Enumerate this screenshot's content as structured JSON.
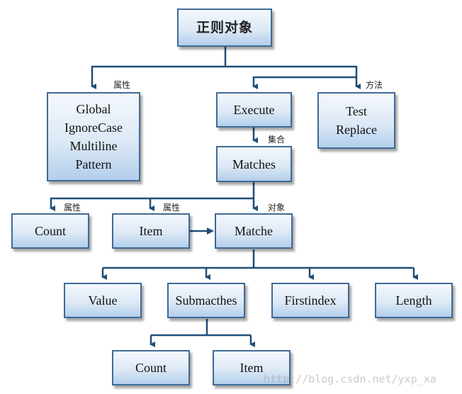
{
  "diagram": {
    "root": "正则对象",
    "properties_label": "属性",
    "methods_label": "方法",
    "collection_label": "集合",
    "object_label": "对象",
    "properties": [
      "Global",
      "IgnoreCase",
      "Multiline",
      "Pattern"
    ],
    "execute": "Execute",
    "methods": [
      "Test",
      "Replace"
    ],
    "matches": "Matches",
    "matches_children": {
      "count": "Count",
      "count_label": "属性",
      "item": "Item",
      "item_label": "属性",
      "matche": "Matche",
      "matche_label": "对象"
    },
    "matche_children": [
      "Value",
      "Submacthes",
      "Firstindex",
      "Length"
    ],
    "submatches_children": [
      "Count",
      "Item"
    ],
    "watermark": "http://blog.csdn.net/yxp_xa",
    "colors": {
      "line": "#1f4e79",
      "border": "#3f6a96",
      "fill_top": "#f4f8fd",
      "fill_bottom": "#b3cfeb"
    }
  }
}
